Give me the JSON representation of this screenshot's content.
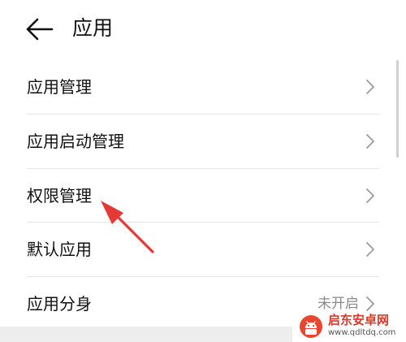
{
  "header": {
    "title": "应用",
    "back_icon": "arrow-left-icon"
  },
  "menu": {
    "items": [
      {
        "label": "应用管理",
        "value": ""
      },
      {
        "label": "应用启动管理",
        "value": ""
      },
      {
        "label": "权限管理",
        "value": ""
      },
      {
        "label": "默认应用",
        "value": ""
      },
      {
        "label": "应用分身",
        "value": "未开启"
      }
    ],
    "chevron_icon": "chevron-right-icon"
  },
  "annotation": {
    "color": "#e53935",
    "icon": "red-arrow-icon"
  },
  "watermark": {
    "title": "启东安卓网",
    "url": "www.qdltdq.com",
    "logo_icon": "android-logo-icon"
  }
}
